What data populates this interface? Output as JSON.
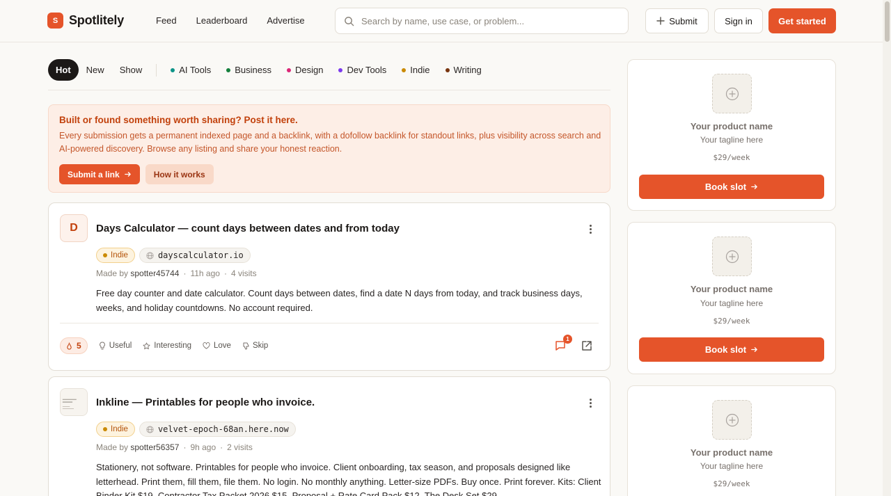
{
  "header": {
    "logo_letter": "S",
    "brand": "Spotlitely",
    "nav": [
      "Feed",
      "Leaderboard",
      "Advertise"
    ],
    "search_placeholder": "Search by name, use case, or problem...",
    "submit_label": "Submit",
    "signin_label": "Sign in",
    "get_started_label": "Get started"
  },
  "filters": {
    "sorts": [
      "Hot",
      "New",
      "Show"
    ],
    "active_sort": "Hot",
    "categories": [
      {
        "label": "AI Tools",
        "color": "#0d9488"
      },
      {
        "label": "Business",
        "color": "#15803d"
      },
      {
        "label": "Design",
        "color": "#db2777"
      },
      {
        "label": "Dev Tools",
        "color": "#7c3aed"
      },
      {
        "label": "Indie",
        "color": "#ca8a04"
      },
      {
        "label": "Writing",
        "color": "#78350f"
      }
    ]
  },
  "banner": {
    "title": "Built or found something worth sharing? Post it here.",
    "text": "Every submission gets a permanent indexed page and a backlink, with a dofollow backlink for standout links, plus visibility across search and AI-powered discovery. Browse any listing and share your honest reaction.",
    "primary_label": "Submit a link",
    "secondary_label": "How it works"
  },
  "posts": [
    {
      "avatar_letter": "D",
      "title": "Days Calculator — count days between dates and from today",
      "category": "Indie",
      "domain": "dayscalculator.io",
      "made_by_prefix": "Made by",
      "author": "spotter45744",
      "time": "11h ago",
      "visits": "4 visits",
      "description": "Free day counter and date calculator. Count days between dates, find a date N days from today, and track business days, weeks, and holiday countdowns. No account required.",
      "votes": "5",
      "reactions": [
        "Useful",
        "Interesting",
        "Love",
        "Skip"
      ],
      "comments": "1"
    },
    {
      "title": "Inkline — Printables for people who invoice.",
      "category": "Indie",
      "domain": "velvet-epoch-68an.here.now",
      "made_by_prefix": "Made by",
      "author": "spotter56357",
      "time": "9h ago",
      "visits": "2 visits",
      "description": "Stationery, not software. Printables for people who invoice. Client onboarding, tax season, and proposals designed like letterhead. Print them, fill them, file them. No login. No monthly anything. Letter-size PDFs. Buy once. Print forever. Kits: Client Binder Kit $19, Contractor Tax Packet 2026 $15, Proposal + Rate Card Pack $12, The Desk Set $29."
    }
  ],
  "slots": [
    {
      "name": "Your product name",
      "tagline": "Your tagline here",
      "price": "$29/week",
      "button": "Book slot"
    },
    {
      "name": "Your product name",
      "tagline": "Your tagline here",
      "price": "$29/week",
      "button": "Book slot"
    },
    {
      "name": "Your product name",
      "tagline": "Your tagline here",
      "price": "$29/week"
    }
  ],
  "colors": {
    "accent": "#e5542a",
    "background": "#faf9f6",
    "banner_bg": "#fdeee6"
  }
}
